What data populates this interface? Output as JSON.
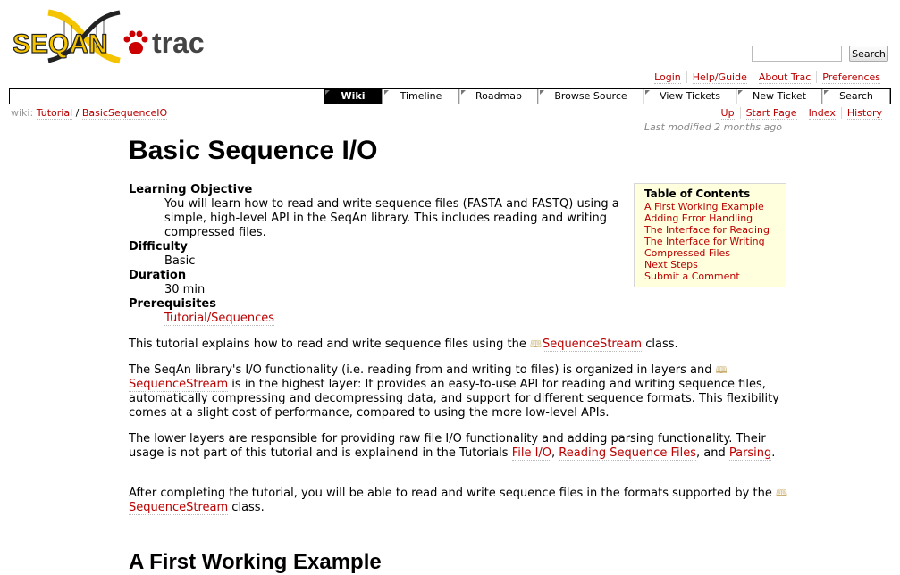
{
  "header": {
    "logo_text_seqan": "SEQAN",
    "logo_text_trac": "trac",
    "search_placeholder": "",
    "search_button": "Search"
  },
  "metanav": [
    "Login",
    "Help/Guide",
    "About Trac",
    "Preferences"
  ],
  "mainnav": [
    {
      "label": "Wiki",
      "active": true
    },
    {
      "label": "Timeline"
    },
    {
      "label": "Roadmap"
    },
    {
      "label": "Browse Source"
    },
    {
      "label": "View Tickets"
    },
    {
      "label": "New Ticket"
    },
    {
      "label": "Search"
    }
  ],
  "breadcrumb": {
    "prefix": "wiki:",
    "parts": [
      "Tutorial",
      "/",
      "BasicSequenceIO"
    ]
  },
  "ctxtnav": [
    "Up",
    "Start Page",
    "Index",
    "History"
  ],
  "last_modified": {
    "prefix": "Last modified ",
    "when": "2 months ago"
  },
  "page": {
    "title": "Basic Sequence I/O",
    "learning_objective_label": "Learning Objective",
    "learning_objective_text": "You will learn how to read and write sequence files (FASTA and FASTQ) using a simple, high-level API in the SeqAn library. This includes reading and writing compressed files.",
    "difficulty_label": "Difficulty",
    "difficulty_value": "Basic",
    "duration_label": "Duration",
    "duration_value": "30 min",
    "prerequisites_label": "Prerequisites",
    "prerequisites_link": "Tutorial/Sequences",
    "p1_before": "This tutorial explains how to read and write sequence files using the ",
    "p1_link": "SequenceStream",
    "p1_after": " class.",
    "p2_before": "The SeqAn library's I/O functionality (i.e. reading from and writing to files) is organized in layers and ",
    "p2_link": "SequenceStream",
    "p2_after": " is in the highest layer: It provides an easy-to-use API for reading and writing sequence files, automatically compressing and decompressing data, and support for different sequence formats. This flexibility comes at a slight cost of performance, compared to using the more low-level APIs.",
    "p3_before": "The lower layers are responsible for providing raw file I/O functionality and adding parsing functionality. Their usage is not part of this tutorial and is explainend in the Tutorials ",
    "p3_link1": "File I/O",
    "p3_sep1": ", ",
    "p3_link2": "Reading Sequence Files",
    "p3_sep2": ", and ",
    "p3_link3": "Parsing",
    "p3_after": ".",
    "p4_before": "After completing the tutorial, you will be able to read and write sequence files in the formats supported by the ",
    "p4_link": "SequenceStream",
    "p4_after": " class.",
    "section_heading": "A First Working Example"
  },
  "toc": {
    "title": "Table of Contents",
    "items": [
      "A First Working Example",
      "Adding Error Handling",
      "The Interface for Reading",
      "The Interface for Writing",
      "Compressed Files",
      "Next Steps",
      "Submit a Comment"
    ]
  }
}
